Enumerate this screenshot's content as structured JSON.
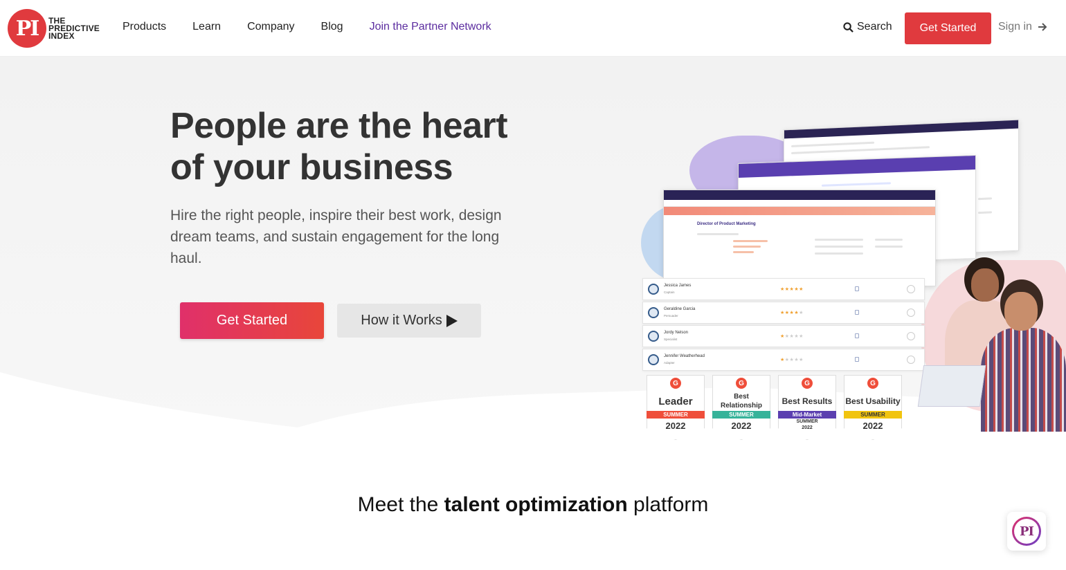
{
  "header": {
    "logo_mark": "PI",
    "logo_lines": [
      "THE",
      "PREDICTIVE",
      "INDEX"
    ],
    "nav": [
      "Products",
      "Learn",
      "Company",
      "Blog",
      "Join the Partner Network"
    ],
    "search_label": "Search",
    "cta_label": "Get Started",
    "signin_label": "Sign in"
  },
  "hero": {
    "title": "People are the heart of your business",
    "subtitle": "Hire the right people, inspire their best work, design dream teams, and sustain engagement for the long haul.",
    "primary_button": "Get Started",
    "secondary_button": "How it Works"
  },
  "illustration": {
    "job_title": "Director of Product Marketing",
    "candidates": [
      {
        "name": "Jessica James",
        "role": "Captain",
        "stars": 5
      },
      {
        "name": "Geraldine Garcia",
        "role": "Persuader",
        "stars": 4
      },
      {
        "name": "Jordy Nelson",
        "role": "Specialist",
        "stars": 1.5
      },
      {
        "name": "Jennifer Weatherhead",
        "role": "Adapter",
        "stars": 1
      }
    ],
    "badges": [
      {
        "title": "Leader",
        "ribbon": "SUMMER",
        "year": "2022",
        "color": "#ef4e3a"
      },
      {
        "title": "Best Relationship",
        "ribbon": "SUMMER",
        "year": "2022",
        "color": "#36b39a"
      },
      {
        "title": "Best Results",
        "ribbon": "Mid-Market",
        "sub": "SUMMER",
        "year": "2022",
        "color": "#5b3fb0"
      },
      {
        "title": "Best Usability",
        "ribbon": "SUMMER",
        "year": "2022",
        "color": "#f1c40f"
      }
    ]
  },
  "section": {
    "heading_pre": "Meet the ",
    "heading_bold": "talent optimization",
    "heading_post": " platform"
  },
  "chat_widget": {
    "mark": "PI"
  }
}
